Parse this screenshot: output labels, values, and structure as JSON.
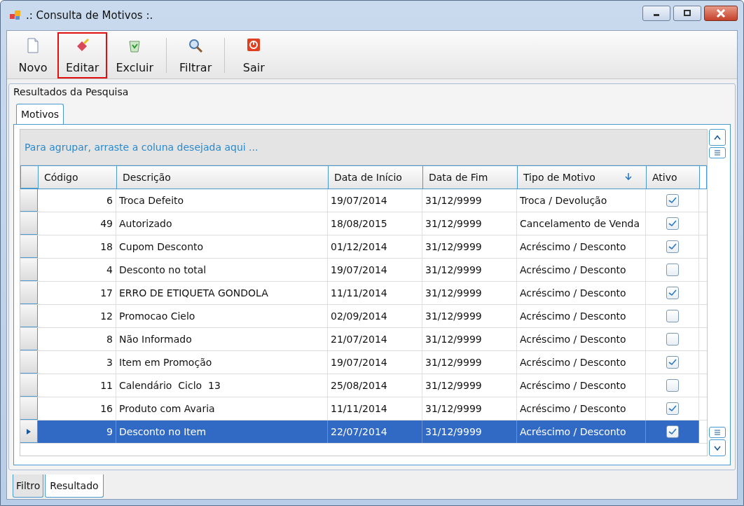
{
  "window": {
    "title": ".: Consulta de Motivos :."
  },
  "toolbar": [
    {
      "label": "Novo",
      "kind": "new",
      "highlighted": false
    },
    {
      "label": "Editar",
      "kind": "edit",
      "highlighted": true
    },
    {
      "label": "Excluir",
      "kind": "delete",
      "highlighted": false
    },
    {
      "label": "Filtrar",
      "kind": "filter",
      "highlighted": false
    },
    {
      "label": "Sair",
      "kind": "exit",
      "highlighted": false
    }
  ],
  "group": {
    "title": "Resultados da Pesquisa"
  },
  "inner_tabs": [
    {
      "label": "Motivos",
      "selected": true
    }
  ],
  "grid": {
    "group_hint": "Para agrupar, arraste a coluna desejada aqui ...",
    "columns": [
      {
        "label": "Código",
        "sorted": false
      },
      {
        "label": "Descrição",
        "sorted": false
      },
      {
        "label": "Data de Início",
        "sorted": false
      },
      {
        "label": "Data de Fim",
        "sorted": false
      },
      {
        "label": "Tipo de Motivo",
        "sorted": true
      },
      {
        "label": "Ativo",
        "sorted": false
      }
    ],
    "rows": [
      {
        "codigo": "6",
        "descricao": "Troca Defeito",
        "inicio": "19/07/2014",
        "fim": "31/12/9999",
        "tipo": "Troca / Devolução",
        "ativo": true,
        "selected": false
      },
      {
        "codigo": "49",
        "descricao": "Autorizado",
        "inicio": "18/08/2015",
        "fim": "31/12/9999",
        "tipo": "Cancelamento de Venda",
        "ativo": true,
        "selected": false
      },
      {
        "codigo": "18",
        "descricao": "Cupom Desconto",
        "inicio": "01/12/2014",
        "fim": "31/12/9999",
        "tipo": "Acréscimo / Desconto",
        "ativo": true,
        "selected": false
      },
      {
        "codigo": "4",
        "descricao": "Desconto no total",
        "inicio": "19/07/2014",
        "fim": "31/12/9999",
        "tipo": "Acréscimo / Desconto",
        "ativo": false,
        "selected": false
      },
      {
        "codigo": "17",
        "descricao": "ERRO DE ETIQUETA GONDOLA",
        "inicio": "11/11/2014",
        "fim": "31/12/9999",
        "tipo": "Acréscimo / Desconto",
        "ativo": true,
        "selected": false
      },
      {
        "codigo": "12",
        "descricao": "Promocao Cielo",
        "inicio": "02/09/2014",
        "fim": "31/12/9999",
        "tipo": "Acréscimo / Desconto",
        "ativo": false,
        "selected": false
      },
      {
        "codigo": "8",
        "descricao": "Não Informado",
        "inicio": "21/07/2014",
        "fim": "31/12/9999",
        "tipo": "Acréscimo / Desconto",
        "ativo": false,
        "selected": false
      },
      {
        "codigo": "3",
        "descricao": "Item em Promoção",
        "inicio": "19/07/2014",
        "fim": "31/12/9999",
        "tipo": "Acréscimo / Desconto",
        "ativo": true,
        "selected": false
      },
      {
        "codigo": "11",
        "descricao": "Calendário  Ciclo  13",
        "inicio": "25/08/2014",
        "fim": "31/12/9999",
        "tipo": "Acréscimo / Desconto",
        "ativo": false,
        "selected": false
      },
      {
        "codigo": "16",
        "descricao": "Produto com Avaria",
        "inicio": "11/11/2014",
        "fim": "31/12/9999",
        "tipo": "Acréscimo / Desconto",
        "ativo": true,
        "selected": false
      },
      {
        "codigo": "9",
        "descricao": "Desconto no Item",
        "inicio": "22/07/2014",
        "fim": "31/12/9999",
        "tipo": "Acréscimo / Desconto",
        "ativo": true,
        "selected": true
      }
    ]
  },
  "bottom_tabs": [
    {
      "label": "Filtro",
      "selected": false
    },
    {
      "label": "Resultado",
      "selected": true
    }
  ]
}
